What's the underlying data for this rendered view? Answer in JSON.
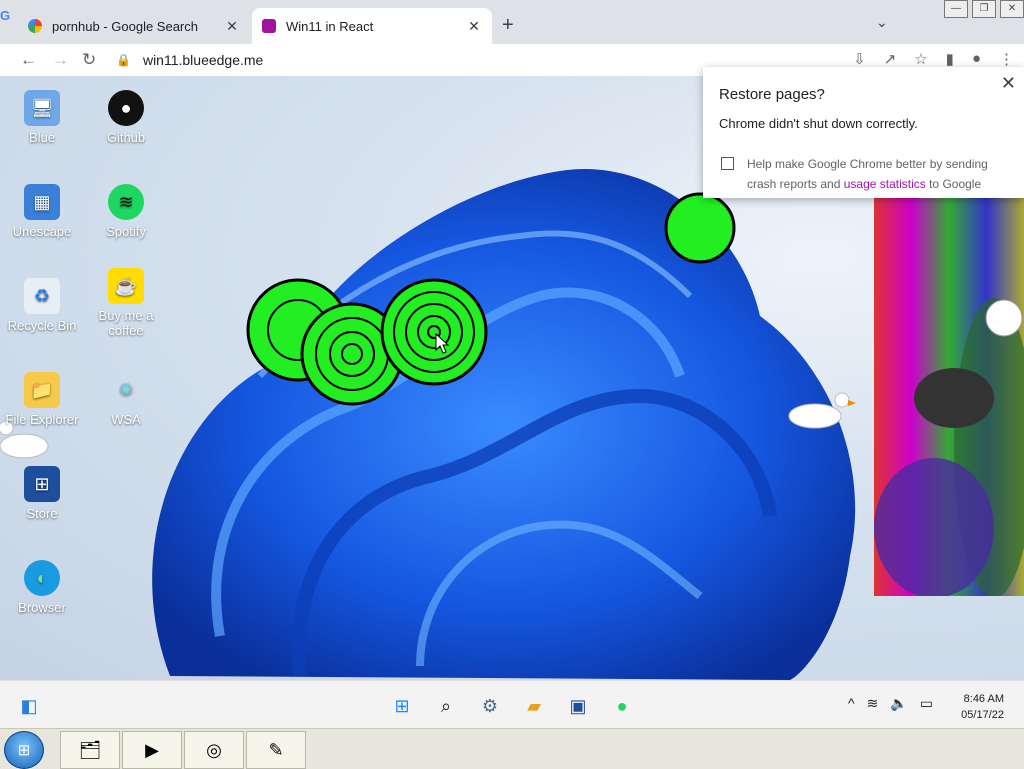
{
  "browser": {
    "tabs": [
      {
        "label": "pornhub - Google Search",
        "favicon": "google-icon"
      },
      {
        "label": "Win11 in React",
        "favicon": "win11-react-icon"
      }
    ],
    "url": "win11.blueedge.me"
  },
  "desktop": {
    "icons": [
      {
        "label": "Blue",
        "icon": "user-pc-icon"
      },
      {
        "label": "Github",
        "icon": "github-icon"
      },
      {
        "label": "Unescape",
        "icon": "unescape-icon"
      },
      {
        "label": "Spotify",
        "icon": "spotify-icon"
      },
      {
        "label": "Recycle Bin",
        "icon": "recycle-bin-icon"
      },
      {
        "label": "Buy me a coffee",
        "icon": "coffee-icon"
      },
      {
        "label": "File Explorer",
        "icon": "folder-icon"
      },
      {
        "label": "WSA",
        "icon": "wsa-icon"
      },
      {
        "label": "Store",
        "icon": "store-icon"
      },
      {
        "label": "Browser",
        "icon": "edge-icon"
      }
    ]
  },
  "restore_dialog": {
    "title": "Restore pages?",
    "message": "Chrome didn't shut down correctly.",
    "help_prefix": "Help make Google Chrome better by sending crash reports and ",
    "help_link": "usage statistics",
    "help_suffix": " to Google"
  },
  "taskbar": {
    "time": "8:46 AM",
    "date": "05/17/22"
  },
  "colors": {
    "accent_blue": "#1a73e8",
    "link_purple": "#a112b1",
    "spiral_green": "#22ee22"
  }
}
